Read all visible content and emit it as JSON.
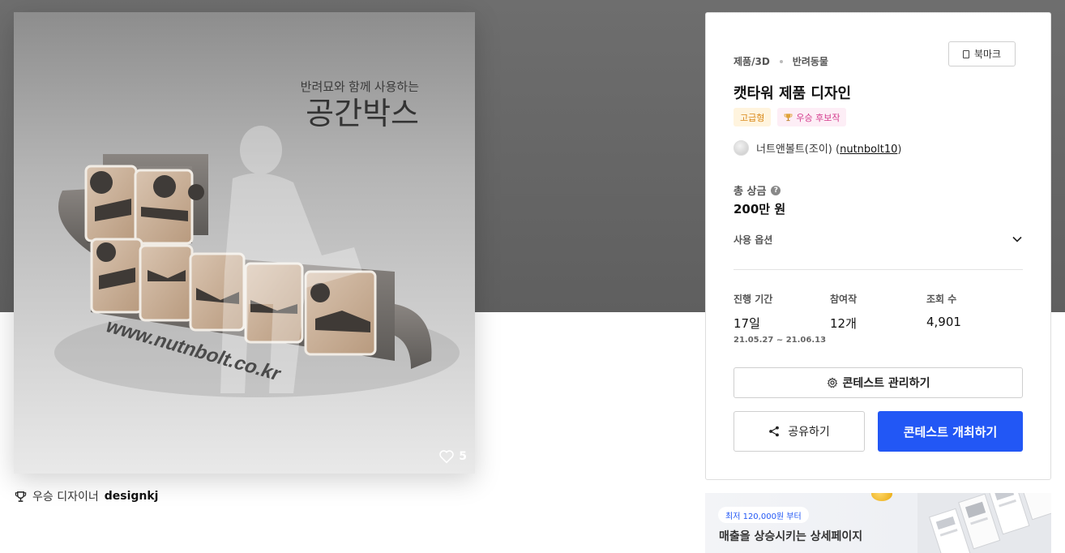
{
  "artwork": {
    "poster_subtitle": "반려묘와 함께 사용하는",
    "poster_title": "공간박스",
    "poster_url": "www.nutnbolt.co.kr",
    "like_count": "5",
    "like_icon": "heart-icon"
  },
  "winner": {
    "icon": "trophy-icon",
    "label": "우승 디자이너",
    "name": "designkj"
  },
  "contest": {
    "category_main": "제품/3D",
    "category_sub": "반려동물",
    "bookmark_label": "북마크",
    "title": "캣타워 제품 디자인",
    "badges": {
      "premium": "고급형",
      "winner": "우승 후보작"
    },
    "owner_name": "너트앤볼트(조이)",
    "owner_id": "nutnbolt10",
    "prize_label": "총 상금",
    "prize_value": "200만 원",
    "usage_option_label": "사용 옵션",
    "stats": {
      "period_label": "진행 기간",
      "period_value": "17일",
      "period_range": "21.05.27 ~ 21.06.13",
      "entries_label": "참여작",
      "entries_value": "12개",
      "views_label": "조회 수",
      "views_value": "4,901"
    },
    "manage_button": "콘테스트 관리하기",
    "share_button": "공유하기",
    "host_button": "콘테스트 개최하기"
  },
  "ad": {
    "pill_text": "최저 120,000원 부터",
    "headline": "매출을 상승시키는 상세페이지"
  },
  "colors": {
    "primary": "#2257f5",
    "hero_bg": "#666666"
  }
}
